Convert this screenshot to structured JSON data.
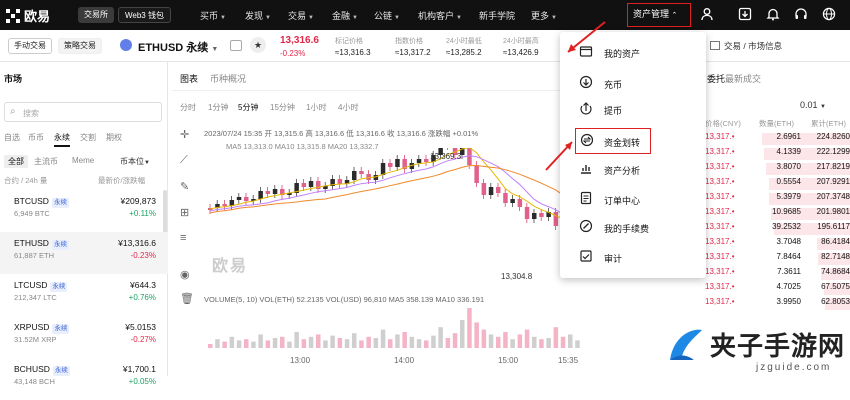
{
  "topnav": {
    "logo": "欧易",
    "seg_exchange": "交易所",
    "seg_web3": "Web3 钱包",
    "items": [
      "买币",
      "发现",
      "交易",
      "金融",
      "公链",
      "机构客户",
      "新手学院",
      "更多"
    ],
    "asset_mgmt": "资产管理"
  },
  "subbar": {
    "tab_manual": "手动交易",
    "tab_strategy": "策略交易",
    "symbol": "ETHUSD 永续",
    "price": "13,316.6",
    "change": "-0.23%",
    "stats": [
      {
        "label": "标记价格",
        "value": "≈13,316.3"
      },
      {
        "label": "指数价格",
        "value": "≈13,317.2"
      },
      {
        "label": "24小时最低",
        "value": "≈13,285.2"
      },
      {
        "label": "24小时最高",
        "value": "≈13,426.9"
      }
    ],
    "right_link": "交易 / 市场信息"
  },
  "left": {
    "title": "市场",
    "search_placeholder": "搜索",
    "tabs": [
      "自选",
      "币币",
      "永续",
      "交割",
      "期权"
    ],
    "filters": [
      "全部",
      "主流币",
      "Meme",
      "币本位"
    ],
    "col_left": "合约 / 24h 量",
    "col_right": "最新价/涨跌幅",
    "rows": [
      {
        "sym": "BTCUSD",
        "vol": "6,949 BTC",
        "price": "¥209,873",
        "chg": "+0.11%",
        "up": true
      },
      {
        "sym": "ETHUSD",
        "vol": "61,887 ETH",
        "price": "¥13,316.6",
        "chg": "-0.23%",
        "up": false
      },
      {
        "sym": "LTCUSD",
        "vol": "212,347 LTC",
        "price": "¥644.3",
        "chg": "+0.76%",
        "up": true
      },
      {
        "sym": "XRPUSD",
        "vol": "31.52M XRP",
        "price": "¥5.0153",
        "chg": "-0.27%",
        "up": false
      },
      {
        "sym": "BCHUSD",
        "vol": "43,148 BCH",
        "price": "¥1,700.1",
        "chg": "+0.05%",
        "up": true
      }
    ],
    "perp_tag": "永续"
  },
  "chart": {
    "tabs": [
      "图表",
      "币种概况"
    ],
    "intervals": [
      "分时",
      "1分钟",
      "5分钟",
      "15分钟",
      "1小时",
      "4小时"
    ],
    "ohlc": "2023/07/24 15:35  开 13,315.6  高 13,316.6  低 13,316.6  收 13,316.6  涨跌幅 +0.01%",
    "ma": "MA5 13,313.0   MA10 13,315.8   MA20 13,332.7",
    "high_label": "13,369.3",
    "low_label": "13,304.8",
    "vol_legend": "VOLUME(5, 10)  VOL(ETH) 52.2135  VOL(USD) 96,810  MA5 358.139  MA10 336.191",
    "x_ticks": [
      "13:00",
      "14:00",
      "15:00",
      "15:35"
    ],
    "watermark": "欧易"
  },
  "menu": {
    "items": [
      {
        "icon": "wallet-icon",
        "label": "我的资产"
      },
      {
        "icon": "deposit-icon",
        "label": "充币"
      },
      {
        "icon": "withdraw-icon",
        "label": "提币"
      },
      {
        "icon": "transfer-icon",
        "label": "资金划转"
      },
      {
        "icon": "analysis-icon",
        "label": "资产分析"
      },
      {
        "icon": "orders-icon",
        "label": "订单中心"
      },
      {
        "icon": "fee-icon",
        "label": "我的手续费"
      },
      {
        "icon": "audit-icon",
        "label": "审计"
      }
    ]
  },
  "orderbook": {
    "tabs": [
      "委托",
      "最新成交"
    ],
    "precision": "0.01",
    "cols": [
      "价格(CNY)",
      "数量(ETH)",
      "累计(ETH)"
    ],
    "rows": [
      {
        "a": "2.6961",
        "t": "224.8260",
        "w": 1.0
      },
      {
        "a": "4.1339",
        "t": "222.1299",
        "w": 0.98
      },
      {
        "a": "3.8070",
        "t": "217.8219",
        "w": 0.96
      },
      {
        "a": "0.5554",
        "t": "207.9291",
        "w": 0.92
      },
      {
        "a": "5.3979",
        "t": "207.3748",
        "w": 0.92
      },
      {
        "a": "10.9685",
        "t": "201.9801",
        "w": 0.9
      },
      {
        "a": "39.2532",
        "t": "195.6117",
        "w": 0.86
      },
      {
        "a": "3.7048",
        "t": "86.4184",
        "w": 0.38
      },
      {
        "a": "7.8464",
        "t": "82.7148",
        "w": 0.36
      },
      {
        "a": "7.3611",
        "t": "74.8684",
        "w": 0.33
      },
      {
        "a": "4.7025",
        "t": "67.5075",
        "w": 0.3
      },
      {
        "a": "3.9950",
        "t": "62.8053",
        "w": 0.28
      }
    ],
    "price_prefix": "13,317."
  },
  "site_watermark": {
    "title": "夹子手游网",
    "url": "jzguide.com"
  }
}
